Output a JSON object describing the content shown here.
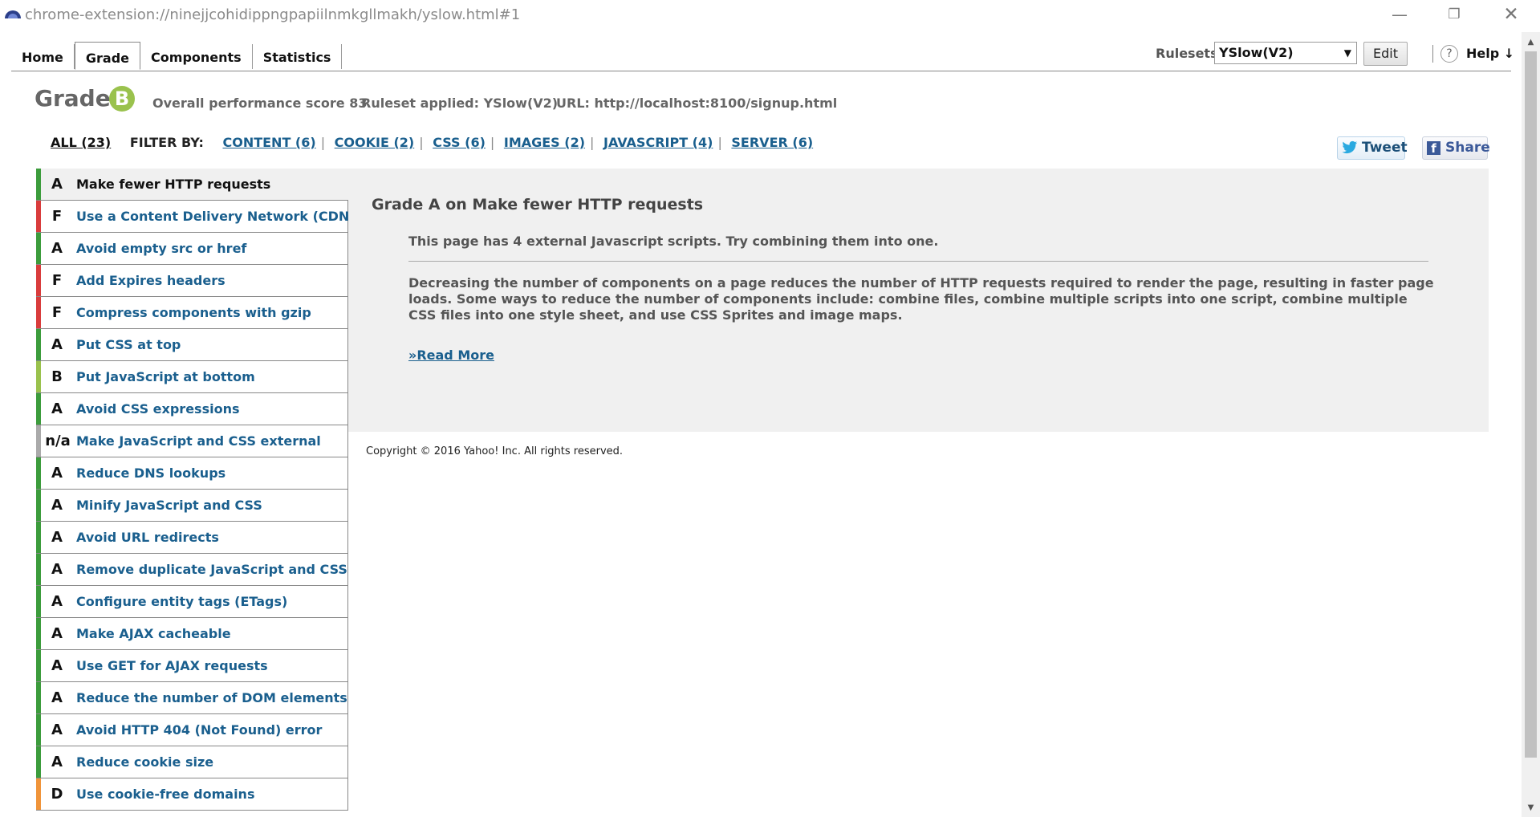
{
  "window": {
    "url": "chrome-extension://ninejjcohidippngpapiilnmkgllmakh/yslow.html#1",
    "minimize_glyph": "—",
    "maximize_glyph": "❐",
    "close_glyph": "✕"
  },
  "tabs": [
    {
      "label": "Home",
      "active": false
    },
    {
      "label": "Grade",
      "active": true
    },
    {
      "label": "Components",
      "active": false
    },
    {
      "label": "Statistics",
      "active": false
    }
  ],
  "toolbar": {
    "rulesets_label": "Rulesets",
    "ruleset_selected": "YSlow(V2)",
    "edit_label": "Edit",
    "help_icon": "?",
    "help_label": "Help ↓"
  },
  "grade": {
    "title": "Grade",
    "letter": "B",
    "score_text": "Overall performance score 83",
    "ruleset_text": "Ruleset applied: YSlow(V2)",
    "url_text": "URL: http://localhost:8100/signup.html"
  },
  "filters": {
    "all": "ALL (23)",
    "filter_by": "FILTER BY:",
    "links": [
      "CONTENT (6)",
      "COOKIE (2)",
      "CSS (6)",
      "IMAGES (2)",
      "JAVASCRIPT (4)",
      "SERVER (6)"
    ]
  },
  "social": {
    "tweet": "Tweet",
    "share": "Share"
  },
  "colors": {
    "grade_a": "#3c9c3c",
    "grade_b": "#9ac24d",
    "grade_d": "#f0943a",
    "grade_f": "#d93c3c",
    "grade_na": "#aaaaaa",
    "link": "#1a5f8e",
    "panel_bg": "#f0f0f0"
  },
  "rules": [
    {
      "grade": "A",
      "label": "Make fewer HTTP requests",
      "selected": true
    },
    {
      "grade": "F",
      "label": "Use a Content Delivery Network (CDN)"
    },
    {
      "grade": "A",
      "label": "Avoid empty src or href"
    },
    {
      "grade": "F",
      "label": "Add Expires headers"
    },
    {
      "grade": "F",
      "label": "Compress components with gzip"
    },
    {
      "grade": "A",
      "label": "Put CSS at top"
    },
    {
      "grade": "B",
      "label": "Put JavaScript at bottom"
    },
    {
      "grade": "A",
      "label": "Avoid CSS expressions"
    },
    {
      "grade": "n/a",
      "label": "Make JavaScript and CSS external"
    },
    {
      "grade": "A",
      "label": "Reduce DNS lookups"
    },
    {
      "grade": "A",
      "label": "Minify JavaScript and CSS"
    },
    {
      "grade": "A",
      "label": "Avoid URL redirects"
    },
    {
      "grade": "A",
      "label": "Remove duplicate JavaScript and CSS"
    },
    {
      "grade": "A",
      "label": "Configure entity tags (ETags)"
    },
    {
      "grade": "A",
      "label": "Make AJAX cacheable"
    },
    {
      "grade": "A",
      "label": "Use GET for AJAX requests"
    },
    {
      "grade": "A",
      "label": "Reduce the number of DOM elements"
    },
    {
      "grade": "A",
      "label": "Avoid HTTP 404 (Not Found) error"
    },
    {
      "grade": "A",
      "label": "Reduce cookie size"
    },
    {
      "grade": "D",
      "label": "Use cookie-free domains"
    }
  ],
  "detail": {
    "title": "Grade A on Make fewer HTTP requests",
    "message": "This page has 4 external Javascript scripts. Try combining them into one.",
    "description": "Decreasing the number of components on a page reduces the number of HTTP requests required to render the page, resulting in faster page loads. Some ways to reduce the number of components include: combine files, combine multiple scripts into one script, combine multiple CSS files into one style sheet, and use CSS Sprites and image maps.",
    "read_more": "»Read More"
  },
  "footer": {
    "copyright": "Copyright © 2016 Yahoo! Inc. All rights reserved."
  }
}
